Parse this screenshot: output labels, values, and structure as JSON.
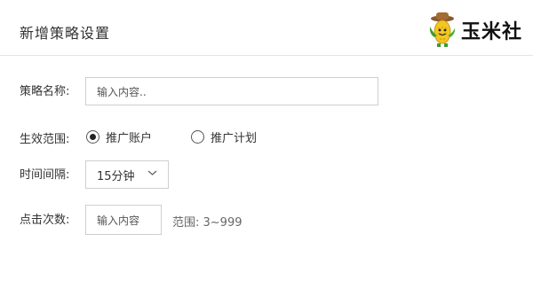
{
  "header": {
    "title": "新增策略设置",
    "brand_text": "玉米社",
    "brand_icon": "corn-mascot-icon"
  },
  "form": {
    "strategy_name": {
      "label": "策略名称:",
      "placeholder": "输入内容..",
      "value": ""
    },
    "scope": {
      "label": "生效范围:",
      "options": [
        {
          "label": "推广账户",
          "selected": true
        },
        {
          "label": "推广计划",
          "selected": false
        }
      ]
    },
    "interval": {
      "label": "时间间隔:",
      "value": "15分钟"
    },
    "clicks": {
      "label": "点击次数:",
      "placeholder": "输入内容",
      "hint": "范围: 3~999"
    }
  }
}
